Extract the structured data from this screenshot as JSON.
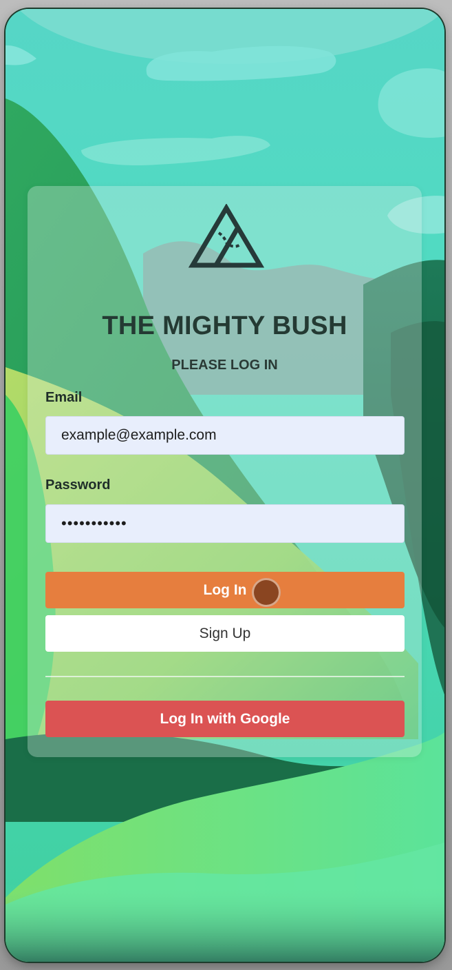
{
  "app": {
    "title": "THE MIGHTY BUSH",
    "subtitle": "PLEASE LOG IN",
    "logo_icon": "triangle-bush-logo-icon"
  },
  "form": {
    "email_label": "Email",
    "email_value": "example@example.com",
    "password_label": "Password",
    "password_value": "•••••••••••"
  },
  "buttons": {
    "login_label": "Log In",
    "signup_label": "Sign Up",
    "google_label": "Log In with Google"
  },
  "colors": {
    "login_button": "#e67e3e",
    "google_button": "#db5353",
    "signup_button": "#ffffff",
    "input_background": "#e8eefc",
    "title_text": "#243a33"
  }
}
